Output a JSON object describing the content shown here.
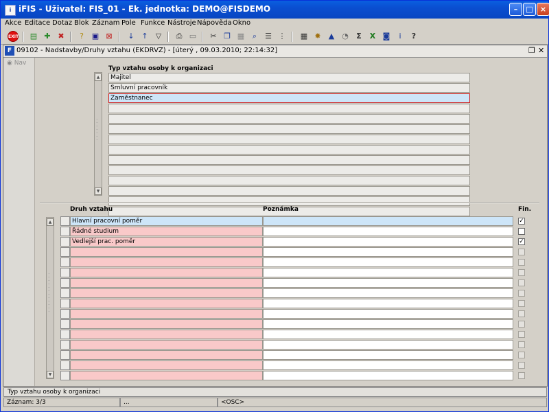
{
  "window": {
    "title": "iFIS - Uživatel: FIS_01 - Ek. jednotka: DEMO@FISDEMO",
    "app_icon": "ifis-icon",
    "buttons": [
      "minimize",
      "maximize",
      "close"
    ]
  },
  "menu": [
    "Akce",
    "Editace",
    "Dotaz",
    "Blok",
    "Záznam",
    "Pole",
    "Funkce",
    "Nástroje",
    "Nápověda",
    "Okno"
  ],
  "toolbar_icons": [
    "exit-icon",
    "save-icon",
    "new-record-icon",
    "delete-record-icon",
    "enter-query-icon",
    "execute-query-icon",
    "cancel-query-icon",
    "sort-asc-icon",
    "sort-desc-icon",
    "filter-icon",
    "print-icon",
    "print-preview-icon",
    "cut-icon",
    "copy-icon",
    "paste-icon",
    "find-icon",
    "list-icon",
    "tree-icon",
    "calculator-icon",
    "settings-icon",
    "chart-icon",
    "clock-icon",
    "sum-icon",
    "excel-icon",
    "export-icon",
    "info-icon",
    "help-icon"
  ],
  "form": {
    "title": "09102 - Nadstavby/Druhy vztahu (EKDRVZ) - [úterý , 09.03.2010; 22:14:32]",
    "nav_label": "Nav"
  },
  "master": {
    "label": "Typ vztahu osoby k organizaci",
    "rows": [
      "Majitel",
      "Smluvní pracovník",
      "Zaměstnanec",
      "",
      "",
      "",
      "",
      "",
      "",
      "",
      "",
      "",
      "",
      ""
    ],
    "current_index": 2
  },
  "detail": {
    "headers": {
      "druh": "Druh vztahu",
      "poznamka": "Poznámka",
      "fin": "Fin."
    },
    "rows": [
      {
        "druh": "Hlavní pracovní poměr",
        "poznamka": "",
        "fin": true
      },
      {
        "druh": "Řádné studium",
        "poznamka": "",
        "fin": false
      },
      {
        "druh": "Vedlejší prac. poměr",
        "poznamka": "",
        "fin": true
      },
      {
        "druh": "",
        "poznamka": "",
        "fin": null
      },
      {
        "druh": "",
        "poznamka": "",
        "fin": null
      },
      {
        "druh": "",
        "poznamka": "",
        "fin": null
      },
      {
        "druh": "",
        "poznamka": "",
        "fin": null
      },
      {
        "druh": "",
        "poznamka": "",
        "fin": null
      },
      {
        "druh": "",
        "poznamka": "",
        "fin": null
      },
      {
        "druh": "",
        "poznamka": "",
        "fin": null
      },
      {
        "druh": "",
        "poznamka": "",
        "fin": null
      },
      {
        "druh": "",
        "poznamka": "",
        "fin": null
      },
      {
        "druh": "",
        "poznamka": "",
        "fin": null
      },
      {
        "druh": "",
        "poznamka": "",
        "fin": null
      },
      {
        "druh": "",
        "poznamka": "",
        "fin": null
      },
      {
        "druh": "",
        "poznamka": "",
        "fin": null
      }
    ]
  },
  "status": {
    "hint": "Typ vztahu osoby k organizaci",
    "record": "Záznam: 3/3",
    "ellipsis": "...",
    "mode": "<OSC>"
  }
}
